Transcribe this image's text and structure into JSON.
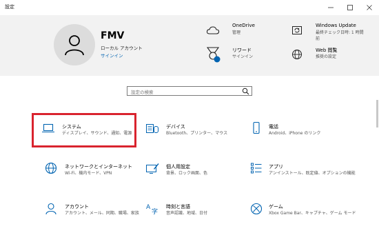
{
  "window": {
    "title": "設定"
  },
  "user": {
    "name": "FMV",
    "account_type": "ローカル アカウント",
    "signin_link": "サインイン"
  },
  "header_items": [
    {
      "title": "OneDrive",
      "sub": "管理",
      "icon": "cloud-icon"
    },
    {
      "title": "Windows Update",
      "sub": "最終チェック日時: 1 時間前",
      "icon": "update-icon"
    },
    {
      "title": "リワード",
      "sub": "サインイン",
      "icon": "rewards-icon"
    },
    {
      "title": "Web 閲覧",
      "sub": "推奨の設定",
      "icon": "globe-icon"
    }
  ],
  "search": {
    "placeholder": "設定の検索"
  },
  "tiles": [
    {
      "title": "システム",
      "desc": "ディスプレイ、サウンド、通知、電源",
      "icon": "laptop-icon"
    },
    {
      "title": "デバイス",
      "desc": "Bluetooth、プリンター、マウス",
      "icon": "keyboard-icon"
    },
    {
      "title": "電話",
      "desc": "Android、iPhone のリンク",
      "icon": "phone-icon"
    },
    {
      "title": "ネットワークとインターネット",
      "desc": "Wi-Fi、機内モード、VPN",
      "icon": "globe-icon"
    },
    {
      "title": "個人用設定",
      "desc": "背景、ロック画面、色",
      "icon": "paint-icon"
    },
    {
      "title": "アプリ",
      "desc": "アンインストール、既定値、オプションの機能",
      "icon": "apps-list-icon"
    },
    {
      "title": "アカウント",
      "desc": "アカウント、メール、同期、職場、家族",
      "icon": "person-icon"
    },
    {
      "title": "時刻と言語",
      "desc": "音声認識、地域、日付",
      "icon": "time-language-icon"
    },
    {
      "title": "ゲーム",
      "desc": "Xbox Game Bar、キャプチャ、ゲーム モード",
      "icon": "xbox-icon"
    }
  ],
  "colors": {
    "accent": "#0063b1",
    "highlight_border": "#d9232e",
    "header_bg": "#f2f2f2"
  }
}
